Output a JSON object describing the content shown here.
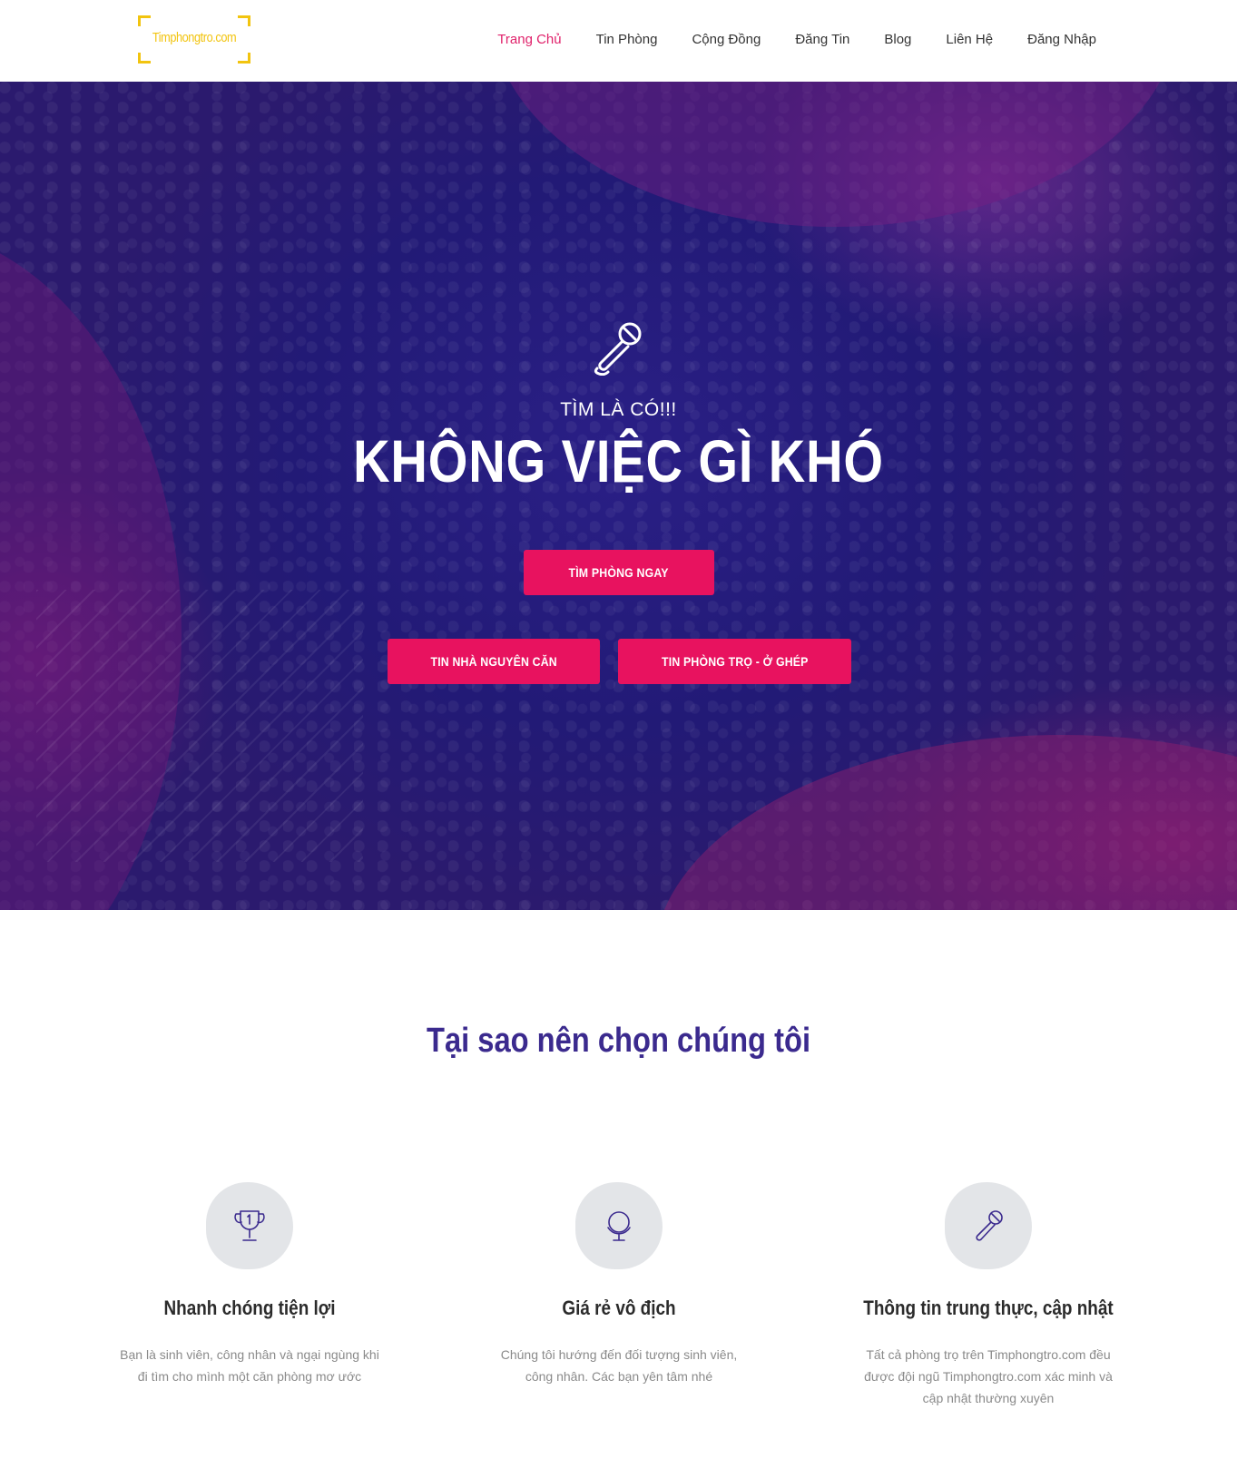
{
  "header": {
    "logo_text": "Timphongtro.com",
    "nav": [
      {
        "label": "Trang Chủ",
        "active": true
      },
      {
        "label": "Tin Phòng",
        "active": false
      },
      {
        "label": "Cộng Đồng",
        "active": false
      },
      {
        "label": "Đăng Tin",
        "active": false
      },
      {
        "label": "Blog",
        "active": false
      },
      {
        "label": "Liên Hệ",
        "active": false
      },
      {
        "label": "Đăng Nhập",
        "active": false
      }
    ]
  },
  "hero": {
    "icon": "microphone-icon",
    "subtitle": "TÌM LÀ CÓ!!!",
    "title": "KHÔNG VIỆC GÌ KHÓ",
    "primary_button": "TÌM PHÒNG NGAY",
    "button_whole_house": "TIN NHÀ NGUYÊN CĂN",
    "button_shared_room": "TIN PHÒNG TRỌ - Ở GHÉP"
  },
  "why": {
    "title": "Tại sao nên chọn chúng tôi",
    "features": [
      {
        "icon": "trophy-icon",
        "title": "Nhanh chóng tiện lợi",
        "text": "Bạn là sinh viên, công nhân và ngại ngùng khi đi tìm cho mình một căn phòng mơ ước"
      },
      {
        "icon": "globe-icon",
        "title": "Giá rẻ vô địch",
        "text": "Chúng tôi hướng đến đối tượng sinh viên, công nhân. Các bạn yên tâm nhé"
      },
      {
        "icon": "microphone-icon",
        "title": "Thông tin trung thực, cập nhật",
        "text": "Tất cả phòng trọ trên Timphongtro.com đều được đội ngũ Timphongtro.com xác minh và cập nhật thường xuyên"
      }
    ]
  },
  "colors": {
    "accent": "#e8125f",
    "nav_active": "#e0226b",
    "heading": "#3b2a8e",
    "logo": "#f2c40f"
  }
}
